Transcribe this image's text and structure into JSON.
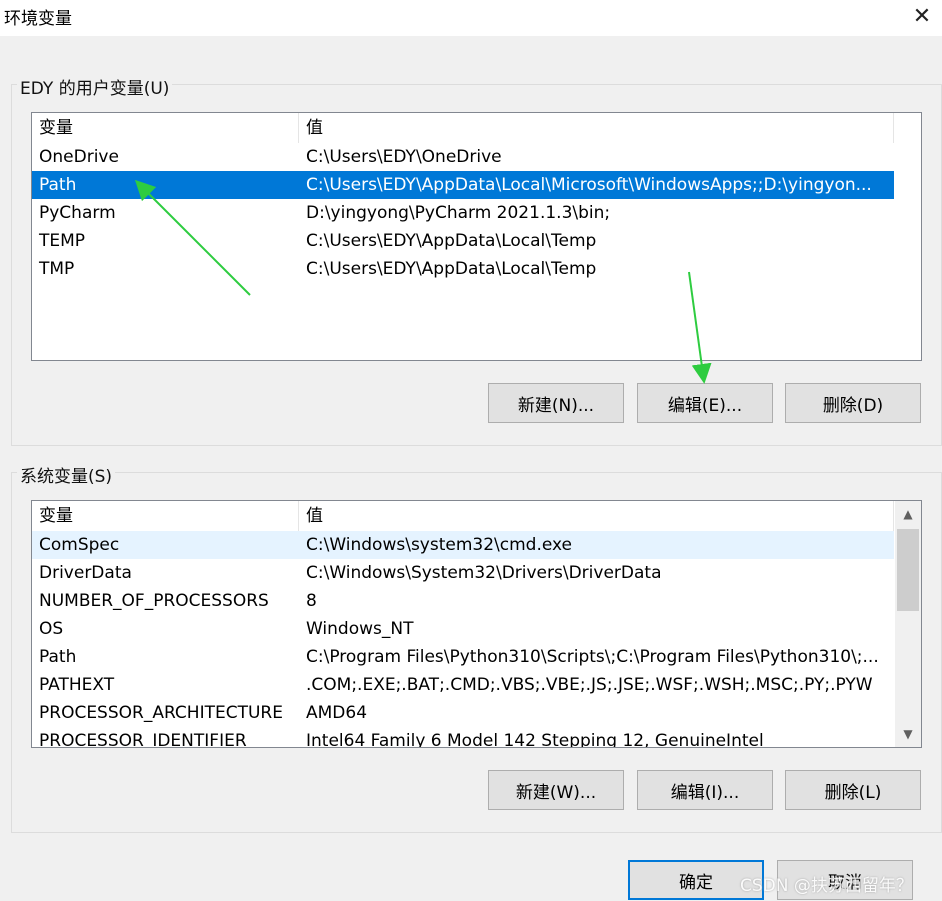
{
  "window": {
    "title": "环境变量",
    "close_glyph": "✕"
  },
  "user_vars": {
    "legend": "EDY 的用户变量(U)",
    "headers": {
      "name": "变量",
      "value": "值"
    },
    "rows": [
      {
        "name": "OneDrive",
        "value": "C:\\Users\\EDY\\OneDrive"
      },
      {
        "name": "Path",
        "value": "C:\\Users\\EDY\\AppData\\Local\\Microsoft\\WindowsApps;;D:\\yingyon..."
      },
      {
        "name": "PyCharm",
        "value": "D:\\yingyong\\PyCharm 2021.1.3\\bin;"
      },
      {
        "name": "TEMP",
        "value": "C:\\Users\\EDY\\AppData\\Local\\Temp"
      },
      {
        "name": "TMP",
        "value": "C:\\Users\\EDY\\AppData\\Local\\Temp"
      }
    ],
    "selected_row": "Path",
    "buttons": {
      "new": "新建(N)...",
      "edit": "编辑(E)...",
      "delete": "删除(D)"
    }
  },
  "system_vars": {
    "legend": "系统变量(S)",
    "headers": {
      "name": "变量",
      "value": "值"
    },
    "rows": [
      {
        "name": "ComSpec",
        "value": "C:\\Windows\\system32\\cmd.exe"
      },
      {
        "name": "DriverData",
        "value": "C:\\Windows\\System32\\Drivers\\DriverData"
      },
      {
        "name": "NUMBER_OF_PROCESSORS",
        "value": "8"
      },
      {
        "name": "OS",
        "value": "Windows_NT"
      },
      {
        "name": "Path",
        "value": "C:\\Program Files\\Python310\\Scripts\\;C:\\Program Files\\Python310\\;..."
      },
      {
        "name": "PATHEXT",
        "value": ".COM;.EXE;.BAT;.CMD;.VBS;.VBE;.JS;.JSE;.WSF;.WSH;.MSC;.PY;.PYW"
      },
      {
        "name": "PROCESSOR_ARCHITECTURE",
        "value": "AMD64"
      },
      {
        "name": "PROCESSOR_IDENTIFIER",
        "value": "Intel64 Family 6 Model 142 Stepping 12, GenuineIntel"
      }
    ],
    "hovered_row": "ComSpec",
    "buttons": {
      "new": "新建(W)...",
      "edit": "编辑(I)...",
      "delete": "删除(L)"
    }
  },
  "footer": {
    "ok": "确定",
    "cancel": "取消"
  },
  "watermark": "CSDN @扶苏西留年？",
  "colors": {
    "selection": "#0078d7",
    "annotation_arrow": "#2ecc40"
  }
}
